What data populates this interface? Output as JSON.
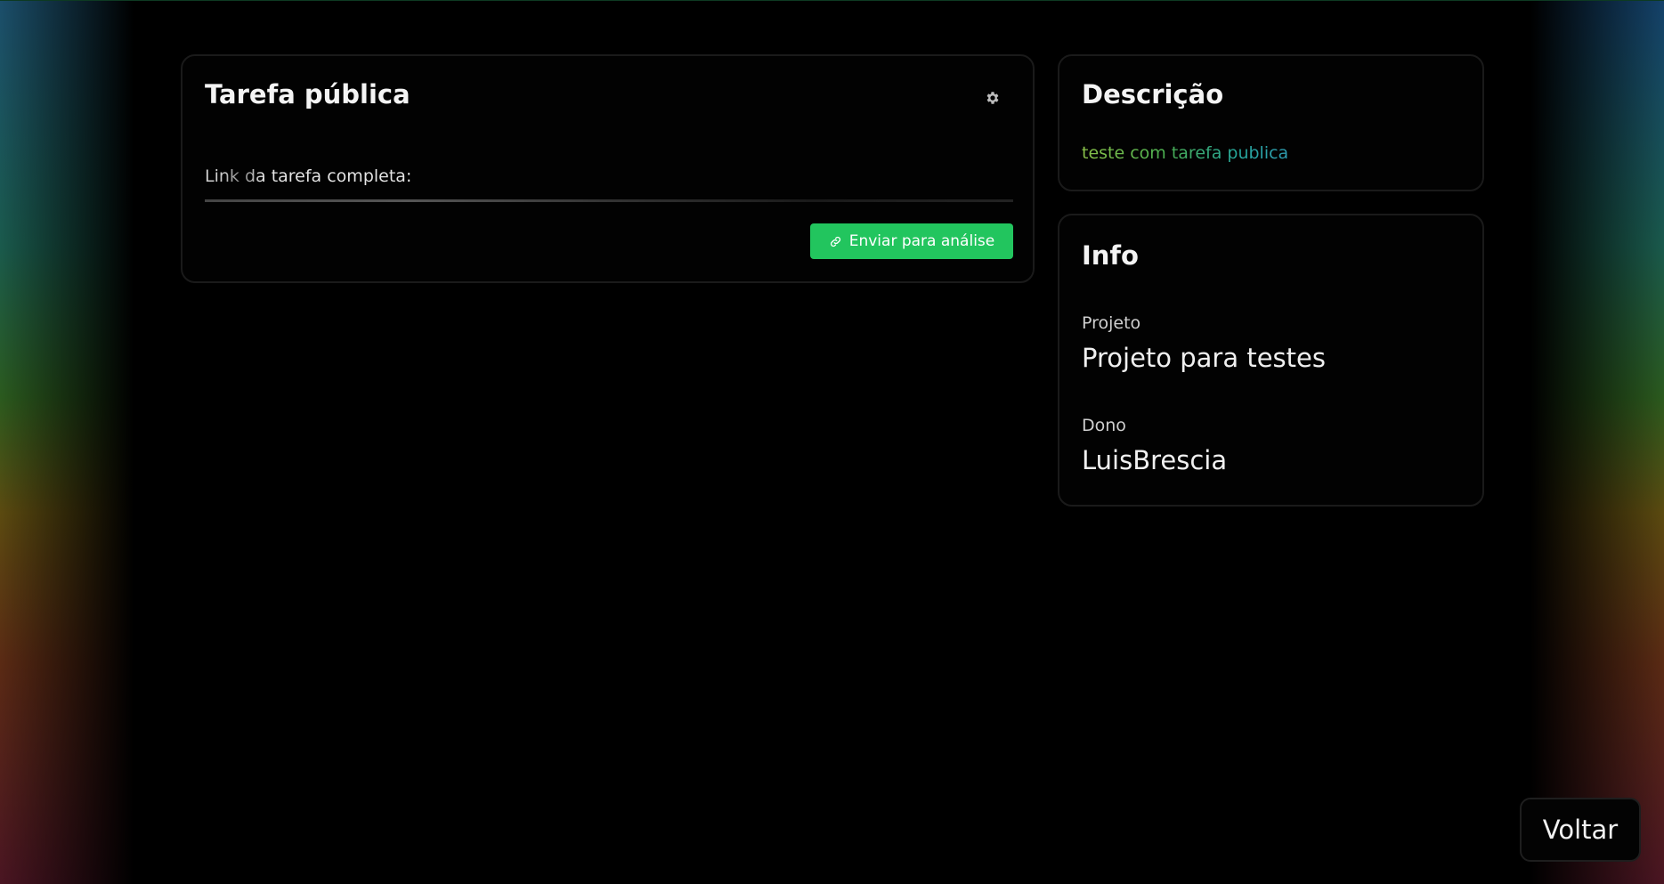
{
  "task_card": {
    "title": "Tarefa pública",
    "field_label": "Link da tarefa completa:",
    "submit_button_label": "Enviar para análise",
    "settings_icon": "gear-icon",
    "submit_icon": "link-icon"
  },
  "description_card": {
    "title": "Descrição",
    "text": "teste com tarefa publica"
  },
  "info_card": {
    "title": "Info",
    "project_label": "Projeto",
    "project_value": "Projeto para testes",
    "owner_label": "Dono",
    "owner_value": "LuisBrescia"
  },
  "back_button_label": "Voltar",
  "colors": {
    "accent_green": "#22c55e",
    "background": "#000000",
    "card_border": "#1a1a1a"
  }
}
